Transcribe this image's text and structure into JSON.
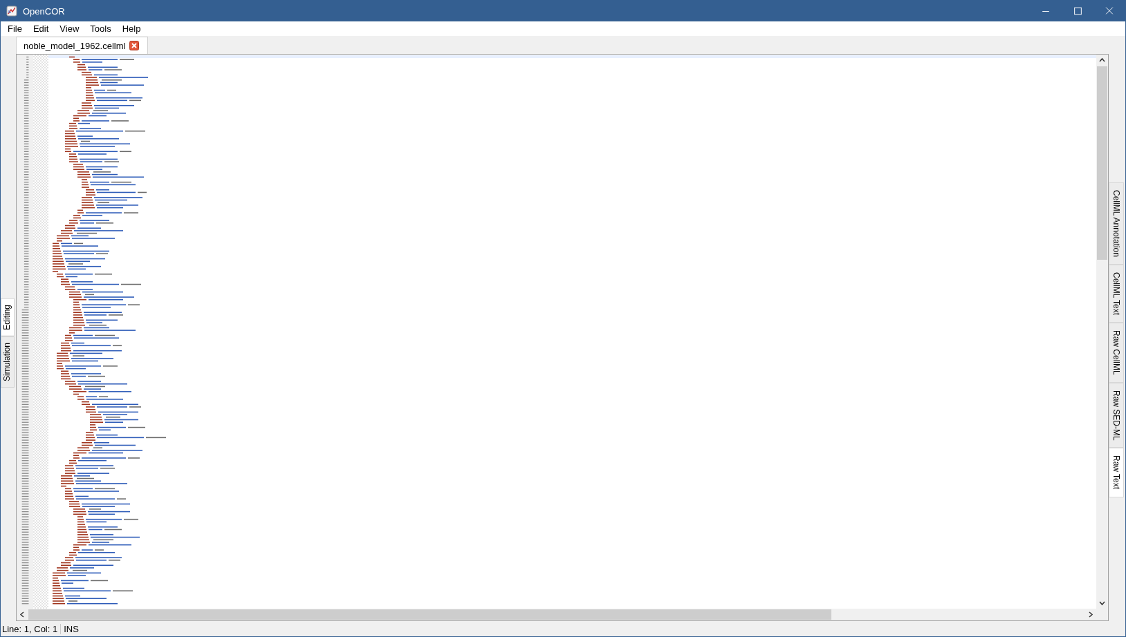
{
  "window": {
    "title": "OpenCOR"
  },
  "menu": [
    "File",
    "Edit",
    "View",
    "Tools",
    "Help"
  ],
  "document_tabs": [
    {
      "label": "noble_model_1962.cellml",
      "selected": true
    }
  ],
  "left_tabs": [
    {
      "label": "Editing",
      "selected": true
    },
    {
      "label": "Simulation",
      "selected": false
    }
  ],
  "right_tabs": [
    {
      "label": "CellML Annotation",
      "selected": false
    },
    {
      "label": "CellML Text",
      "selected": false
    },
    {
      "label": "Raw CellML",
      "selected": false
    },
    {
      "label": "Raw SED-ML",
      "selected": false
    },
    {
      "label": "Raw Text",
      "selected": true
    }
  ],
  "status_bar": {
    "position": "Line: 1, Col: 1",
    "mode": "INS"
  }
}
